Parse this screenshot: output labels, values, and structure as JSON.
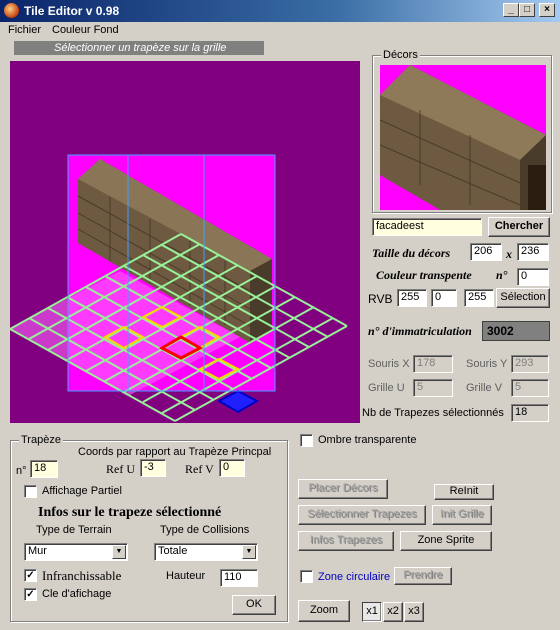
{
  "window": {
    "title": "Tile Editor   v 0.98"
  },
  "menu": [
    "Fichier",
    "Couleur Fond"
  ],
  "hint": "Sélectionner un trapèze sur la grille",
  "decors": {
    "legend": "Décors",
    "filename": "facadeest",
    "search_label": "Chercher",
    "size_label": "Taille du décors",
    "width": "206",
    "x_sep": "x",
    "height": "236",
    "transparent_label": "Couleur transpente",
    "n_label": "n°",
    "n_value": "0",
    "rvb_label": "RVB",
    "r": "255",
    "g": "0",
    "b": "255",
    "selection_label": "Sélection",
    "registration_label": "n° d'immatriculation",
    "registration_value": "3002"
  },
  "mouse": {
    "souris_x_label": "Souris X",
    "souris_x": "178",
    "souris_y_label": "Souris Y",
    "souris_y": "293",
    "grille_u_label": "Grille U",
    "grille_u": "5",
    "grille_v_label": "Grille V",
    "grille_v": "5",
    "selected_label": "Nb de Trapezes sélectionnés",
    "selected_value": "18"
  },
  "trapeze": {
    "legend": "Trapèze",
    "coords_title": "Coords par rapport au Trapèze Princpal",
    "n_label": "n°",
    "n_value": "18",
    "ref_u_label": "Ref U",
    "ref_u": "-3",
    "ref_v_label": "Ref V",
    "ref_v": "0",
    "partial_label": "Affichage Partiel",
    "info_title": "Infos sur le trapeze sélectionné",
    "terrain_label": "Type de Terrain",
    "terrain_value": "Mur",
    "collision_label": "Type de Collisions",
    "collision_value": "Totale",
    "impassable_label": "Infranchissable",
    "height_label": "Hauteur",
    "height_value": "110",
    "display_key_label": "Cle d'afichage",
    "ok_label": "OK"
  },
  "right_controls": {
    "shadow_label": "Ombre transparente",
    "place_label": "Placer Décors",
    "reinit_label": "ReInit",
    "select_trap_label": "Sélectionner Trapezes",
    "init_grid_label": "Init Grille",
    "info_trap_label": "Infos Trapezes",
    "zone_sprite_label": "Zone Sprite",
    "circular_label": "Zone circulaire",
    "take_label": "Prendre",
    "zoom_label": "Zoom",
    "zoom_options": [
      "x1",
      "x2",
      "x3"
    ]
  },
  "colors": {
    "canvas_bg": "#800080",
    "magenta": "#ff00ff",
    "grid": "#90ee90",
    "highlight": "#ffd700",
    "selected": "#ff0000",
    "title_bar": "#0a246a"
  }
}
